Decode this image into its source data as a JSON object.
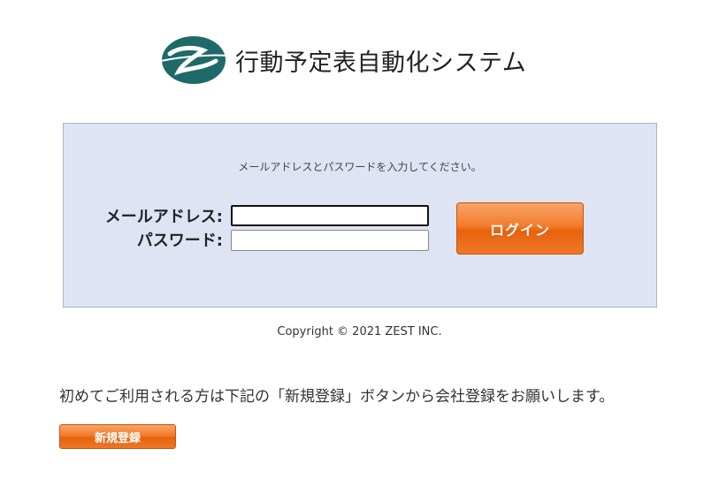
{
  "header": {
    "title": "行動予定表自動化システム",
    "logo_icon": "z-swirl-logo-icon",
    "logo_color": "#1e6a68"
  },
  "login": {
    "instruction": "メールアドレスとパスワードを入力してください。",
    "email_label": "メールアドレス:",
    "email_value": "",
    "password_label": "パスワード:",
    "password_value": "",
    "login_button": "ログイン"
  },
  "footer": {
    "copyright": "Copyright © 2021 ZEST INC."
  },
  "register": {
    "notice": "初めてご利用される方は下記の「新規登録」ボタンから会社登録をお願いします。",
    "button": "新規登録"
  },
  "colors": {
    "panel_bg": "#dfe4f4",
    "accent_orange": "#f27d2c",
    "logo_teal": "#1e6a68"
  }
}
